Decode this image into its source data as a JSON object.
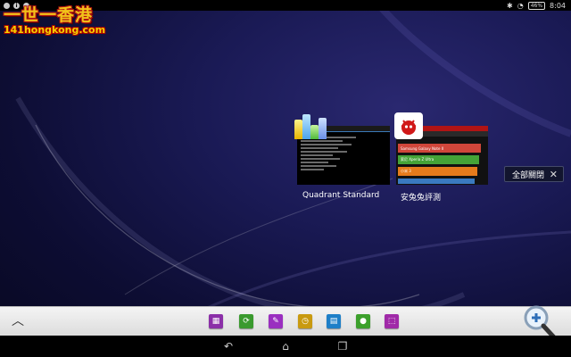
{
  "statusbar": {
    "battery": "46%",
    "time": "8:04"
  },
  "watermark": {
    "line1": "一世一香港",
    "line2": "141hongkong.com"
  },
  "recent_apps": [
    {
      "label": "Quadrant Standard",
      "icon": "quadrant-icon"
    },
    {
      "label": "安兔兔評測",
      "icon": "antutu-icon"
    }
  ],
  "antutu_preview": {
    "bars": [
      "Samsung Galaxy Note II",
      "索尼 Xperia Z Ultra",
      "小米 3"
    ]
  },
  "close_all": {
    "label": "全部關閉",
    "icon": "close-icon"
  },
  "dock": {
    "expand_icon": "chevron-up-icon",
    "apps": [
      {
        "name": "dock-app-1",
        "color": "#8b2fa8",
        "icon": "calculator-icon"
      },
      {
        "name": "dock-app-2",
        "color": "#3a9a2e",
        "icon": "refresh-icon"
      },
      {
        "name": "dock-app-3",
        "color": "#9a2fc0",
        "icon": "pencil-icon"
      },
      {
        "name": "dock-app-4",
        "color": "#c99a10",
        "icon": "timer-icon"
      },
      {
        "name": "dock-app-5",
        "color": "#1e7fc8",
        "icon": "grid-icon"
      },
      {
        "name": "dock-app-6",
        "color": "#3ca02c",
        "icon": "microphone-icon"
      },
      {
        "name": "dock-app-7",
        "color": "#a02aa8",
        "icon": "screenshot-icon"
      }
    ],
    "magnifier_icon": "zoom-in-icon"
  },
  "navbar": {
    "back_icon": "back-icon",
    "home_icon": "home-icon",
    "recents_icon": "recents-icon"
  }
}
